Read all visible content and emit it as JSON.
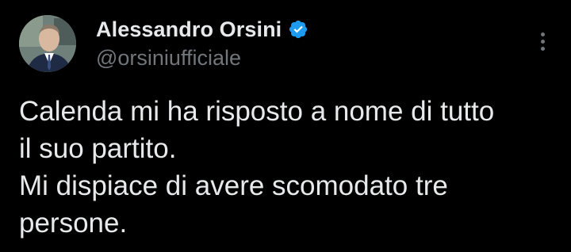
{
  "author": {
    "display_name": "Alessandro Orsini",
    "handle": "@orsiniufficiale",
    "verified": true
  },
  "icons": {
    "verified": "verified-badge-icon",
    "more": "more-options-icon",
    "avatar": "profile-photo"
  },
  "tweet": {
    "lines": [
      "Calenda mi ha risposto a nome di tutto",
      "il suo partito.",
      "Mi dispiace di avere scomodato tre",
      "persone."
    ]
  },
  "colors": {
    "background": "#000000",
    "text_primary": "#e7e9ea",
    "text_secondary": "#71767b",
    "verified_blue": "#1d9bf0"
  }
}
